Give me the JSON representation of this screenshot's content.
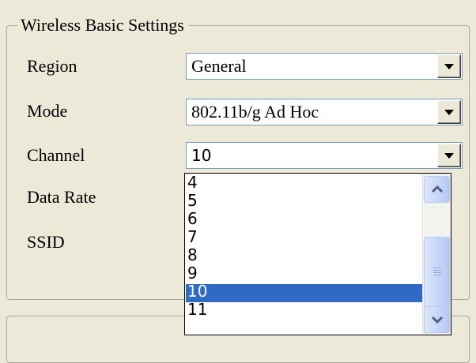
{
  "group": {
    "title": "Wireless Basic Settings"
  },
  "fields": [
    {
      "label": "Region",
      "value": "General"
    },
    {
      "label": "Mode",
      "value": "802.11b/g Ad Hoc"
    },
    {
      "label": "Channel",
      "value": "10"
    },
    {
      "label": "Data Rate"
    },
    {
      "label": "SSID"
    }
  ],
  "channel_dropdown": {
    "options": [
      "4",
      "5",
      "6",
      "7",
      "8",
      "9",
      "10",
      "11"
    ],
    "selected": "10",
    "scroll_position_fraction": 0.55
  },
  "icons": {
    "combo_button": "chevron-down-icon",
    "scroll_up": "chevron-up-icon",
    "scroll_down": "chevron-down-icon",
    "scroll_grip": "grip-icon"
  },
  "colors": {
    "background": "#ece9d8",
    "selection": "#316ac5",
    "scrollbar": "#c6d6f7"
  }
}
